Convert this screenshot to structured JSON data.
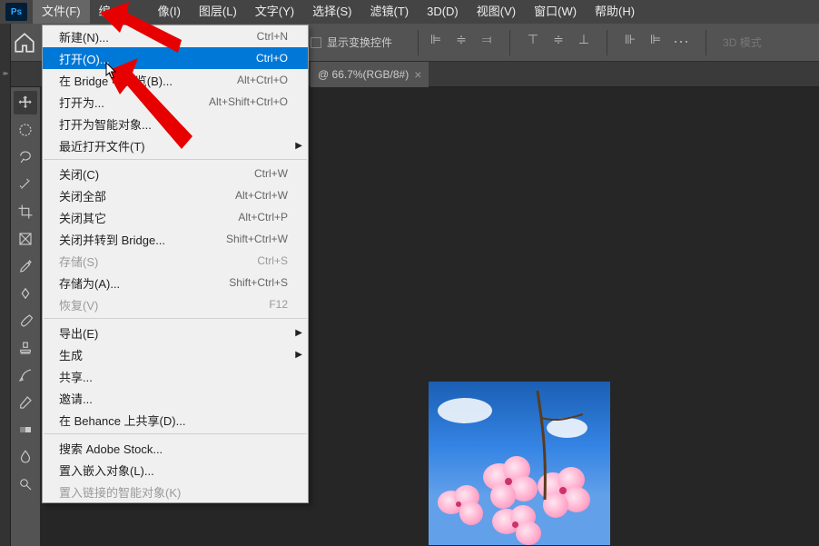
{
  "menubar": {
    "items": [
      "文件(F)",
      "编",
      "像(I)",
      "图层(L)",
      "文字(Y)",
      "选择(S)",
      "滤镜(T)",
      "3D(D)",
      "视图(V)",
      "窗口(W)",
      "帮助(H)"
    ]
  },
  "options": {
    "transform_label": "显示变换控件",
    "mode_3d": "3D 模式"
  },
  "tab": {
    "title": "@ 66.7%(RGB/8#)"
  },
  "dropdown": {
    "items": [
      {
        "label": "新建(N)...",
        "shortcut": "Ctrl+N",
        "type": "item"
      },
      {
        "label": "打开(O)...",
        "shortcut": "Ctrl+O",
        "type": "item",
        "highlight": true
      },
      {
        "label": "在 Bridge 中浏览(B)...",
        "shortcut": "Alt+Ctrl+O",
        "type": "item"
      },
      {
        "label": "打开为...",
        "shortcut": "Alt+Shift+Ctrl+O",
        "type": "item"
      },
      {
        "label": "打开为智能对象...",
        "shortcut": "",
        "type": "item"
      },
      {
        "label": "最近打开文件(T)",
        "shortcut": "",
        "type": "item",
        "submenu": true
      },
      {
        "type": "sep"
      },
      {
        "label": "关闭(C)",
        "shortcut": "Ctrl+W",
        "type": "item"
      },
      {
        "label": "关闭全部",
        "shortcut": "Alt+Ctrl+W",
        "type": "item"
      },
      {
        "label": "关闭其它",
        "shortcut": "Alt+Ctrl+P",
        "type": "item"
      },
      {
        "label": "关闭并转到 Bridge...",
        "shortcut": "Shift+Ctrl+W",
        "type": "item"
      },
      {
        "label": "存储(S)",
        "shortcut": "Ctrl+S",
        "type": "item",
        "disabled": true
      },
      {
        "label": "存储为(A)...",
        "shortcut": "Shift+Ctrl+S",
        "type": "item"
      },
      {
        "label": "恢复(V)",
        "shortcut": "F12",
        "type": "item",
        "disabled": true
      },
      {
        "type": "sep"
      },
      {
        "label": "导出(E)",
        "shortcut": "",
        "type": "item",
        "submenu": true
      },
      {
        "label": "生成",
        "shortcut": "",
        "type": "item",
        "submenu": true
      },
      {
        "label": "共享...",
        "shortcut": "",
        "type": "item"
      },
      {
        "label": "邀请...",
        "shortcut": "",
        "type": "item"
      },
      {
        "label": "在 Behance 上共享(D)...",
        "shortcut": "",
        "type": "item"
      },
      {
        "type": "sep"
      },
      {
        "label": "搜索 Adobe Stock...",
        "shortcut": "",
        "type": "item"
      },
      {
        "label": "置入嵌入对象(L)...",
        "shortcut": "",
        "type": "item"
      },
      {
        "label": "置入链接的智能对象(K)",
        "shortcut": "",
        "type": "item",
        "disabled": true
      }
    ]
  }
}
